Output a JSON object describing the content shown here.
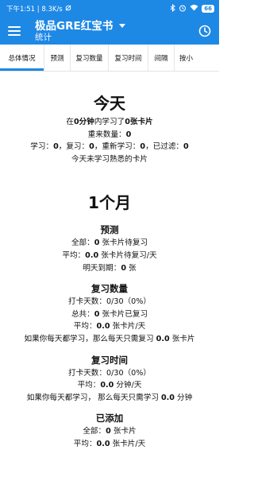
{
  "status_bar": {
    "time_speed": "下午1:51 | 8.3K/s",
    "battery": "66"
  },
  "appbar": {
    "title": "极品GRE红宝书",
    "subtitle": "统计"
  },
  "tabs": [
    "总体情况",
    "预测",
    "复习数量",
    "复习时间",
    "间隔",
    "按小"
  ],
  "today": {
    "heading": "今天",
    "studied_pre": "在",
    "studied_minutes": "0分钟",
    "studied_mid": "内学习了",
    "studied_cards": "0张卡片",
    "relearn_label": "重来数量：",
    "relearn_value": "0",
    "learn_label": "学习：",
    "learn_value": "0",
    "review_label": "，复习：",
    "review_value": "0",
    "relearn2_label": "，重新学习：",
    "relearn2_value": "0",
    "filtered_label": "，已过滤：",
    "filtered_value": "0",
    "mature_note": "今天未学习熟悉的卡片"
  },
  "month": {
    "heading": "1个月",
    "forecast": {
      "title": "预测",
      "total_label": "全部：",
      "total_value": "0",
      "total_unit": " 张卡片待复习",
      "avg_label": "平均：",
      "avg_value": "0.0",
      "avg_unit": " 张卡片待复习/天",
      "tomorrow_label": "明天到期：",
      "tomorrow_value": "0",
      "tomorrow_unit": " 张"
    },
    "review_count": {
      "title": "复习数量",
      "days_label": "打卡天数：",
      "days_value": "0/30（0%）",
      "total_label": "总共：",
      "total_value": "0",
      "total_unit": " 张卡片已复习",
      "avg_label": "平均：",
      "avg_value": "0.0",
      "avg_unit": " 张卡片/天",
      "if_label": "如果你每天都学习，那么每天只需复习 ",
      "if_value": "0.0",
      "if_unit": " 张卡片"
    },
    "review_time": {
      "title": "复习时间",
      "days_label": "打卡天数：",
      "days_value": "0/30（0%）",
      "avg_label": "平均：",
      "avg_value": "0.0",
      "avg_unit": " 分钟/天",
      "if_label": "如果你每天都学习，  那么每天只需学习 ",
      "if_value": "0.0",
      "if_unit": " 分钟"
    },
    "added": {
      "title": "已添加",
      "total_label": "全部：",
      "total_value": "0",
      "total_unit": " 张卡片",
      "avg_label": "平均：",
      "avg_value": "0.0",
      "avg_unit": " 张卡片/天"
    }
  },
  "colors": {
    "primary": "#1e88e5",
    "tab_indicator": "#1e88e5"
  },
  "icons": [
    "hamburger-menu-icon",
    "dropdown-caret-icon",
    "clock-icon",
    "bluetooth-icon",
    "alarm-icon",
    "wifi-icon"
  ]
}
